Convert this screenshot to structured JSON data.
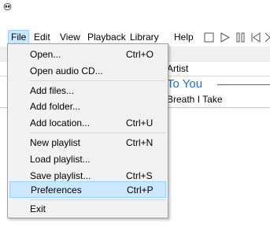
{
  "menubar": {
    "items": [
      "File",
      "Edit",
      "View",
      "Playback",
      "Library",
      "Help"
    ],
    "toolbar_icons": [
      "stop-icon",
      "play-icon",
      "pause-icon",
      "previous-icon",
      "next-icon"
    ]
  },
  "playlist": {
    "column_header": "Artist",
    "group_title": "To You",
    "track_artist": "Breath I Take"
  },
  "file_menu": {
    "items": [
      {
        "label": "Open...",
        "shortcut": "Ctrl+O"
      },
      {
        "label": "Open audio CD...",
        "shortcut": ""
      },
      {
        "label": "Add files...",
        "shortcut": ""
      },
      {
        "label": "Add folder...",
        "shortcut": ""
      },
      {
        "label": "Add location...",
        "shortcut": "Ctrl+U"
      },
      {
        "label": "New playlist",
        "shortcut": "Ctrl+N"
      },
      {
        "label": "Load playlist...",
        "shortcut": ""
      },
      {
        "label": "Save playlist...",
        "shortcut": "Ctrl+S"
      },
      {
        "label": "Preferences",
        "shortcut": "Ctrl+P"
      },
      {
        "label": "Exit",
        "shortcut": ""
      }
    ]
  },
  "colors": {
    "highlight": "#cce8ff",
    "highlight_border": "#99d1ff",
    "group_title": "#1e6fd0"
  }
}
